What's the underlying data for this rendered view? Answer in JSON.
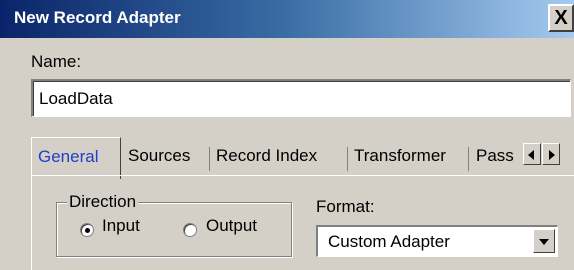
{
  "window": {
    "title": "New Record Adapter",
    "close_label": "X",
    "title_gradient": [
      "#0a246a",
      "#a6caf0"
    ]
  },
  "name_field": {
    "label": "Name:",
    "value": "LoadData"
  },
  "tabs": [
    {
      "label": "General",
      "active": true
    },
    {
      "label": "Sources",
      "active": false
    },
    {
      "label": "Record Index",
      "active": false
    },
    {
      "label": "Transformer",
      "active": false
    },
    {
      "label": "Pass",
      "active": false
    }
  ],
  "tab_scroll": {
    "left_icon": "arrow-left-icon",
    "right_icon": "arrow-right-icon"
  },
  "direction": {
    "legend": "Direction",
    "options": [
      {
        "label": "Input",
        "selected": true
      },
      {
        "label": "Output",
        "selected": false
      }
    ]
  },
  "format": {
    "label": "Format:",
    "selected": "Custom Adapter",
    "dropdown_icon": "chevron-down-icon"
  },
  "colors": {
    "active_tab_text": "#1f3fc8",
    "dialog_background": "#d4d0c8"
  }
}
